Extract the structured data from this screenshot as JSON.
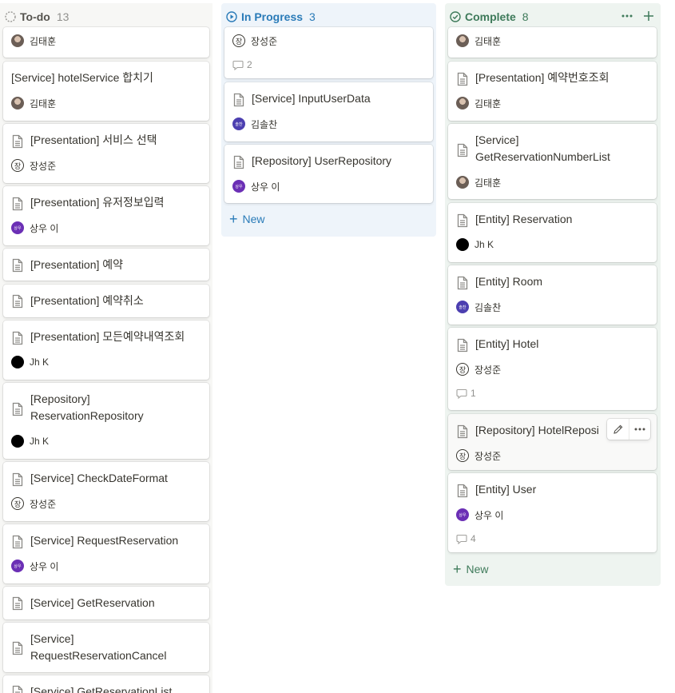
{
  "columns": {
    "todo": {
      "title": "To-do",
      "count": "13",
      "cards": [
        {
          "title": "",
          "person": "김태훈",
          "avatar": "photo"
        },
        {
          "title": "[Service] hotelService 합치기",
          "person": "김태훈",
          "avatar": "photo",
          "icon": false
        },
        {
          "title": "[Presentation] 서비스 선택",
          "person": "장성준",
          "avatar": "jang"
        },
        {
          "title": "[Presentation] 유저정보입력",
          "person": "상우 이",
          "avatar": "sangwoo"
        },
        {
          "title": "[Presentation] 예약"
        },
        {
          "title": "[Presentation] 예약취소"
        },
        {
          "title": "[Presentation] 모든예약내역조회",
          "person": "Jh K",
          "avatar": "jh"
        },
        {
          "title_line1": "[Repository]",
          "title_line2": "ReservationRepository",
          "person": "Jh K",
          "avatar": "jh"
        },
        {
          "title": "[Service] CheckDateFormat",
          "person": "장성준",
          "avatar": "jang"
        },
        {
          "title": "[Service] RequestReservation",
          "person": "상우 이",
          "avatar": "sangwoo"
        },
        {
          "title": "[Service] GetReservation"
        },
        {
          "title_line1": "[Service]",
          "title_line2": "RequestReservationCancel"
        },
        {
          "title": "[Service] GetReservationList"
        }
      ]
    },
    "in_progress": {
      "title": "In Progress",
      "count": "3",
      "new_label": "New",
      "cards": [
        {
          "title": "",
          "person": "장성준",
          "avatar": "jang",
          "comments": "2"
        },
        {
          "title": "[Service] InputUserData",
          "person": "김솔찬",
          "avatar": "kimsol"
        },
        {
          "title": "[Repository] UserRepository",
          "person": "상우 이",
          "avatar": "sangwoo"
        }
      ]
    },
    "complete": {
      "title": "Complete",
      "count": "8",
      "new_label": "New",
      "cards": [
        {
          "title": "",
          "person": "김태훈",
          "avatar": "photo"
        },
        {
          "title": "[Presentation] 예약번호조회",
          "person": "김태훈",
          "avatar": "photo"
        },
        {
          "title_line1": "[Service]",
          "title_line2": "GetReservationNumberList",
          "person": "김태훈",
          "avatar": "photo"
        },
        {
          "title": "[Entity] Reservation",
          "person": "Jh K",
          "avatar": "jh"
        },
        {
          "title": "[Entity] Room",
          "person": "김솔찬",
          "avatar": "kimsol"
        },
        {
          "title": "[Entity] Hotel",
          "person": "장성준",
          "avatar": "jang",
          "comments": "1"
        },
        {
          "title": "[Repository] HotelReposi",
          "person": "장성준",
          "avatar": "jang"
        },
        {
          "title": "[Entity] User",
          "person": "상우 이",
          "avatar": "sangwoo",
          "comments": "4"
        }
      ]
    }
  },
  "avatar_initials": {
    "jang": "장",
    "sangwoo": "상우",
    "kimsol": "솔찬"
  },
  "colors": {
    "in_progress": "#2a7bb8",
    "complete": "#3e7a5a",
    "todo_bg": "#f7f7f5",
    "progress_bg": "#eef4fa",
    "complete_bg": "#eef4f0"
  },
  "icons": [
    "status-todo-icon",
    "status-progress-icon",
    "status-complete-icon",
    "page-icon",
    "comment-icon",
    "plus-icon",
    "more-icon",
    "edit-icon"
  ]
}
